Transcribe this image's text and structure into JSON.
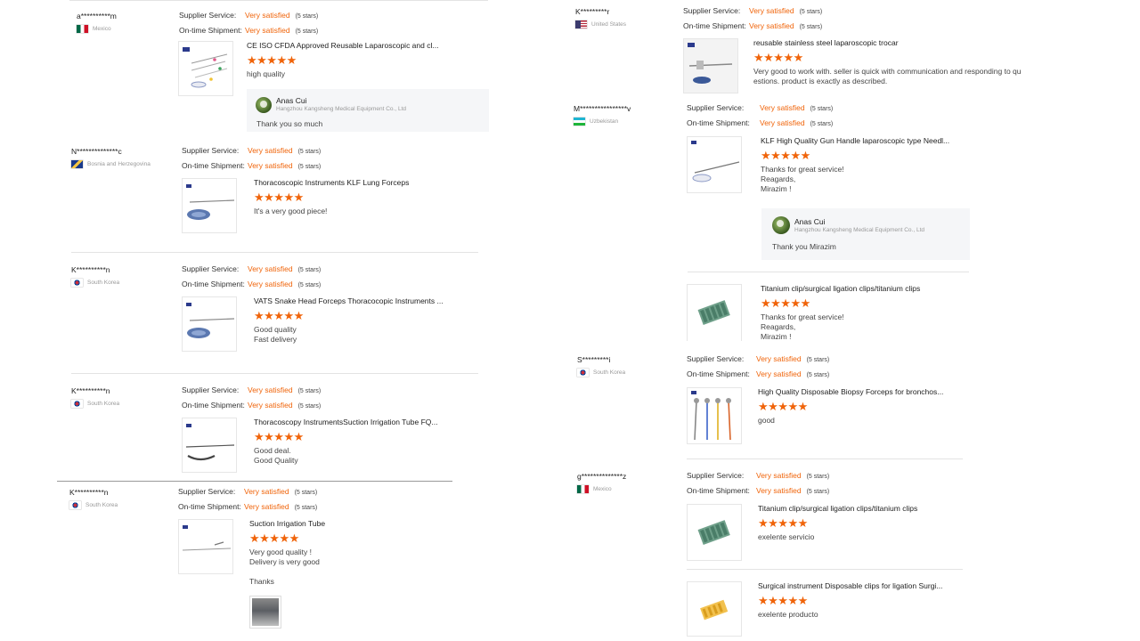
{
  "labels": {
    "supplier_service": "Supplier Service:",
    "on_time_shipment": "On-time Shipment:",
    "rating_value": "Very satisfied",
    "rating_stars": "(5 stars)",
    "stars": "★★★★★"
  },
  "reviews": [
    {
      "reviewer": "a**********m",
      "country": "Mexico",
      "flag": "mexico-flag",
      "product": "CE ISO CFDA Approved Reusable Laparoscopic and cl...",
      "product_icon": "laparoscopic-instruments-icon",
      "comment": [
        "high quality"
      ],
      "reply": {
        "name": "Anas Cui",
        "company": "Hangzhou Kangsheng Medical Equipment Co., Ltd",
        "text": "Thank you so much"
      }
    },
    {
      "reviewer": "N**************c",
      "country": "Bosnia and Herzegovina",
      "flag": "bosnia-flag",
      "product": "Thoracoscopic Instruments KLF Lung Forceps",
      "product_icon": "forceps-icon",
      "comment": [
        "It's a very good piece!"
      ]
    },
    {
      "reviewer": "K**********n",
      "country": "South Korea",
      "flag": "south-korea-flag",
      "product": "VATS Snake Head Forceps Thoracocopic Instruments ...",
      "product_icon": "forceps-icon",
      "comment": [
        "Good quality",
        "Fast delivery"
      ]
    },
    {
      "reviewer": "K**********n",
      "country": "South Korea",
      "flag": "south-korea-flag",
      "product": "Thoracoscopy InstrumentsSuction Irrigation Tube FQ...",
      "product_icon": "suction-tube-icon",
      "comment": [
        "Good deal.",
        "Good Quality"
      ]
    },
    {
      "reviewer": "K**********n",
      "country": "South Korea",
      "flag": "south-korea-flag",
      "product": "Suction Irrigation Tube",
      "product_icon": "suction-tube-icon",
      "comment": [
        "Very good quality !",
        "Delivery is very good",
        "",
        "Thanks"
      ]
    },
    {
      "reviewer": "K*********r",
      "country": "United States",
      "flag": "united-states-flag",
      "product": "reusable stainless steel laparoscopic trocar",
      "product_icon": "trocar-icon",
      "comment": [
        "Very good to work with. seller is quick with  communication and responding to qu",
        "estions. product is exactly as described."
      ]
    },
    {
      "reviewer": "M****************v",
      "country": "Uzbekistan",
      "flag": "uzbekistan-flag",
      "product": "KLF High Quality Gun Handle laparoscopic type Needl...",
      "product_icon": "needle-holder-icon",
      "comment": [
        "Thanks for great service!",
        "Reagards,",
        "Mirazim !"
      ],
      "reply": {
        "name": "Anas Cui",
        "company": "Hangzhou Kangsheng Medical Equipment Co., Ltd",
        "text": "Thank you Mirazim"
      },
      "extra_product": {
        "product": "Titanium clip/surgical ligation clips/titanium clips",
        "product_icon": "titanium-clips-icon",
        "comment": [
          "Thanks for great service!",
          "Reagards,",
          "Mirazim !"
        ]
      }
    },
    {
      "reviewer": "S*********i",
      "country": "South Korea",
      "flag": "south-korea-flag",
      "product": "High Quality Disposable Biopsy Forceps for bronchos...",
      "product_icon": "biopsy-forceps-icon",
      "comment": [
        "good"
      ]
    },
    {
      "reviewer": "g**************z",
      "country": "Mexico",
      "flag": "mexico-flag",
      "product": "Titanium clip/surgical ligation clips/titanium clips",
      "product_icon": "titanium-clips-icon",
      "comment": [
        "exelente servicio"
      ],
      "extra_product": {
        "product": "Surgical instrument Disposable clips for ligation Surgi...",
        "product_icon": "ligation-clips-icon",
        "comment": [
          "exelente producto"
        ]
      }
    }
  ]
}
